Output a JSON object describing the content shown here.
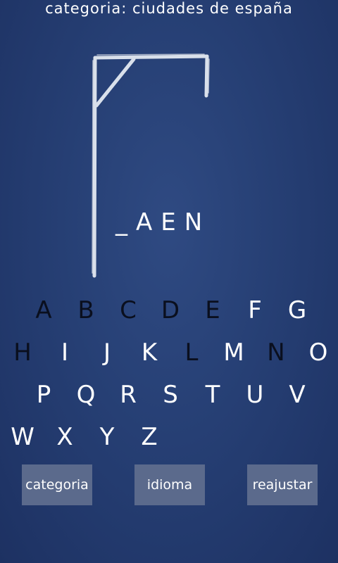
{
  "header": {
    "category_text": "categoria: ciudades de españa"
  },
  "game": {
    "word_display": "_AEN",
    "letters": [
      "A",
      "B",
      "C",
      "D",
      "E",
      "F",
      "G",
      "H",
      "I",
      "J",
      "K",
      "L",
      "M",
      "N",
      "O",
      "P",
      "Q",
      "R",
      "S",
      "T",
      "U",
      "V",
      "W",
      "X",
      "Y",
      "Z"
    ],
    "used_letters": [
      "A",
      "B",
      "C",
      "D",
      "E",
      "H",
      "L",
      "N"
    ]
  },
  "buttons": {
    "category": "categoria",
    "language": "idioma",
    "reset": "reajustar"
  },
  "colors": {
    "background": "#263f74",
    "button": "#5b6a8c",
    "used_letter": "#0a0f1e",
    "available_letter": "#ffffff"
  }
}
